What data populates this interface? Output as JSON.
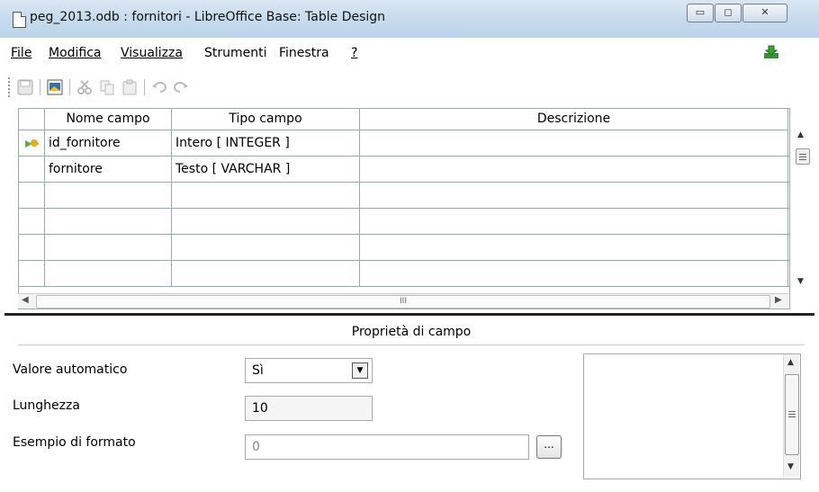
{
  "window": {
    "title": "peg_2013.odb : fornitori - LibreOffice Base: Table Design",
    "controls": {
      "minimize": "▭",
      "maximize": "◻",
      "close": "✕"
    }
  },
  "menu": {
    "items": [
      {
        "label": "File"
      },
      {
        "label": "Modifica"
      },
      {
        "label": "Visualizza"
      },
      {
        "label": "Strumenti"
      },
      {
        "label": "Finestra"
      },
      {
        "label": "?"
      }
    ]
  },
  "toolbar": {
    "icons": [
      "save-icon",
      "edit-icon",
      "cut-icon",
      "copy-icon",
      "paste-icon",
      "undo-icon",
      "redo-icon"
    ]
  },
  "grid": {
    "headers": [
      "Nome campo",
      "Tipo campo",
      "Descrizione"
    ],
    "rows": [
      {
        "name": "id_fornitore",
        "type": "Intero [ INTEGER ]",
        "desc": "",
        "primary_key": true
      },
      {
        "name": "fornitore",
        "type": "Testo [ VARCHAR ]",
        "desc": "",
        "primary_key": false
      },
      {
        "name": "",
        "type": "",
        "desc": ""
      },
      {
        "name": "",
        "type": "",
        "desc": ""
      },
      {
        "name": "",
        "type": "",
        "desc": ""
      },
      {
        "name": "",
        "type": "",
        "desc": ""
      }
    ],
    "hscroll_label": "III"
  },
  "properties": {
    "header": "Proprietà di campo",
    "auto_value_label": "Valore automatico",
    "auto_value": "Sì",
    "length_label": "Lunghezza",
    "length_value": "10",
    "format_label": "Esempio di formato",
    "format_value": "0",
    "format_button": "..."
  },
  "colors": {
    "pk_icon": "#e0b020"
  }
}
